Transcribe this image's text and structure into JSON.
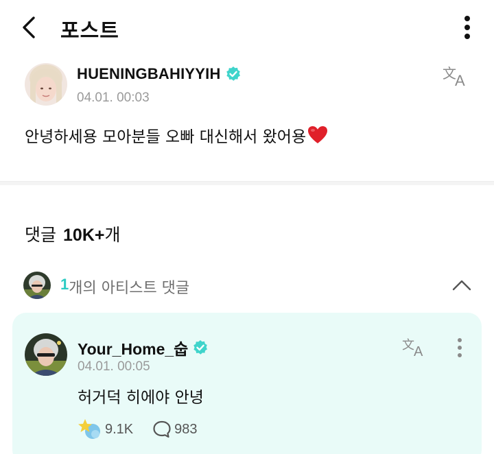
{
  "header": {
    "title": "포스트",
    "back_icon": "chevron-left-icon",
    "more_icon": "vertical-ellipsis-icon"
  },
  "post": {
    "author": "HUENINGBAHIYYIH",
    "timestamp": "04.01. 00:03",
    "body": "안녕하세용 모아분들 오빠 대신해서 왔어용",
    "verified_icon": "verified-badge-icon",
    "translate_icon": "translate-icon",
    "emoji_icon": "red-heart-icon"
  },
  "comments": {
    "label": "댓글",
    "count": "10K+",
    "suffix": "개",
    "artist_summary": {
      "count": "1",
      "text": "개의 아티스트 댓글",
      "collapse_icon": "chevron-up-icon"
    },
    "items": [
      {
        "author": "Your_Home_숩",
        "timestamp": "04.01. 00:05",
        "body": "허거덕 히에야 안녕",
        "likes": "9.1K",
        "replies": "983",
        "like_icon": "star-fan-reaction-icon",
        "reply_icon": "speech-bubble-icon"
      }
    ]
  },
  "colors": {
    "accent": "#2ccbc3",
    "verified": "#3fd4cb",
    "comment_card_bg": "#e9fbf8",
    "muted_text": "#9a9a9a",
    "heart": "#e0202a"
  }
}
